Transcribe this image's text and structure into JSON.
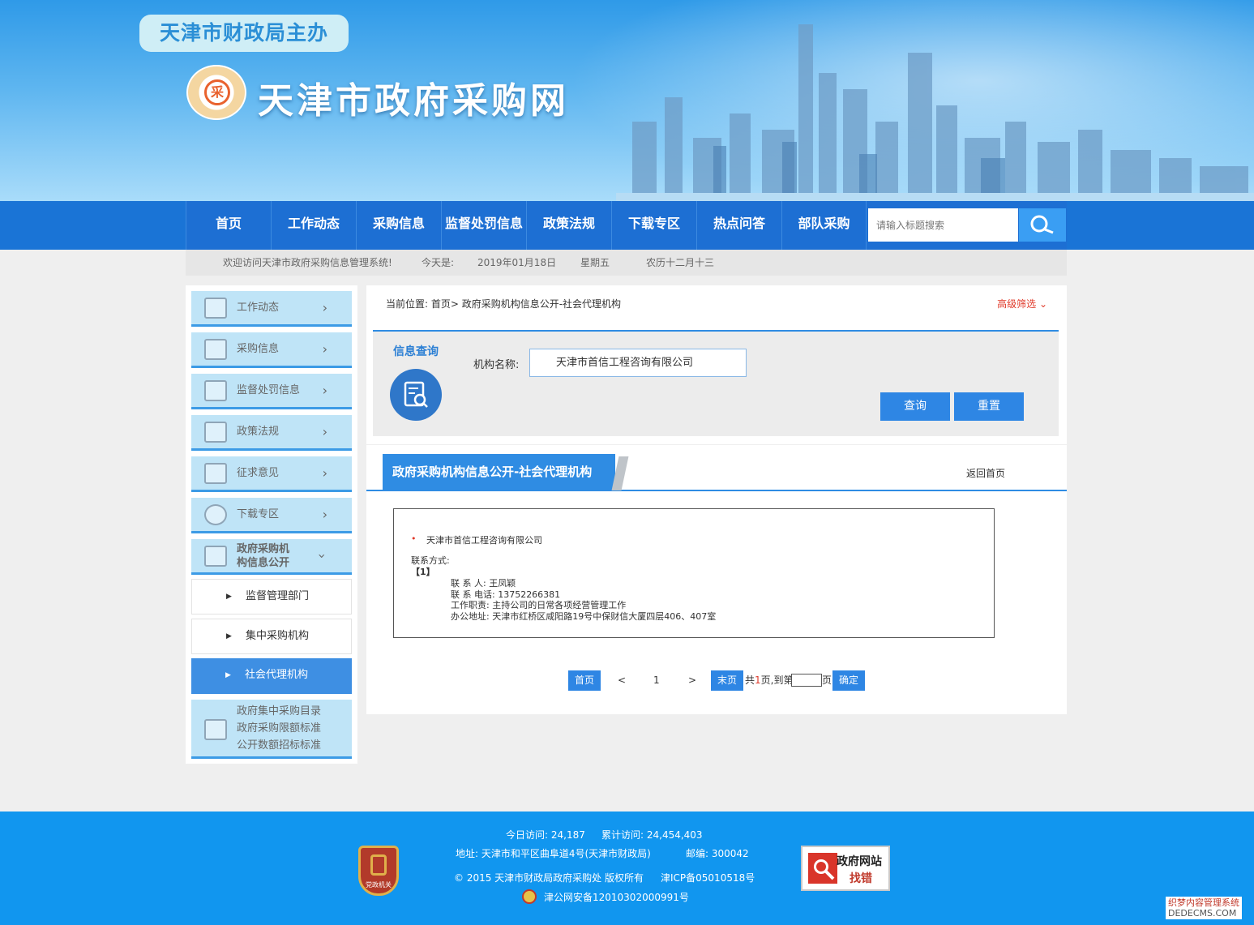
{
  "header": {
    "sponsor": "天津市财政局主办",
    "site_name": "天津市政府采购网",
    "logo_char": "采"
  },
  "nav": {
    "items": [
      "首页",
      "工作动态",
      "采购信息",
      "监督处罚信息",
      "政策法规",
      "下载专区",
      "热点问答",
      "部队采购"
    ],
    "search_placeholder": "请输入标题搜索"
  },
  "infobar": {
    "welcome": "欢迎访问天津市政府采购信息管理系统!",
    "today_label": "今天是:",
    "date": "2019年01月18日",
    "weekday": "星期五",
    "lunar": "农历十二月十三"
  },
  "sidebar": {
    "items": [
      "工作动态",
      "采购信息",
      "监督处罚信息",
      "政策法规",
      "征求意见",
      "下载专区"
    ],
    "expanded": {
      "line1": "政府采购机",
      "line2": "构信息公开"
    },
    "sub_items": [
      "监督管理部门",
      "集中采购机构",
      "社会代理机构"
    ],
    "bottom": [
      "政府集中采购目录",
      "政府采购限额标准",
      "公开数额招标标准"
    ]
  },
  "breadcrumb": "当前位置: 首页> 政府采购机构信息公开-社会代理机构",
  "advanced_filter": "高级筛选",
  "query": {
    "title": "信息查询",
    "label": "机构名称:",
    "value": "天津市首信工程咨询有限公司",
    "search_btn": "查询",
    "reset_btn": "重置"
  },
  "content": {
    "tab_title": "政府采购机构信息公开-社会代理机构",
    "back_home": "返回首页",
    "company": "天津市首信工程咨询有限公司",
    "contact_label": "联系方式:",
    "index": "【1】",
    "contact_person": "联 系 人: 王凤颖",
    "contact_phone": "联 系 电话: 13752266381",
    "duty": "工作职责: 主持公司的日常各项经营管理工作",
    "address": "办公地址: 天津市红桥区咸阳路19号中保财信大厦四层406、407室"
  },
  "pager": {
    "first": "首页",
    "prev": "<",
    "page": "1",
    "next": ">",
    "last": "末页",
    "total_prefix": "共",
    "total": "1",
    "total_suffix": "页,到第",
    "page_suffix": "页",
    "confirm": "确定"
  },
  "footer": {
    "today_visits": "今日访问: 24,187",
    "total_visits": "累计访问: 24,454,403",
    "address": "地址: 天津市和平区曲阜道4号(天津市财政局)",
    "postcode": "邮编: 300042",
    "copyright": "© 2015 天津市财政局政府采购处 版权所有",
    "icp": "津ICP备05010518号",
    "police": "津公网安备12010302000991号",
    "badge_text": "党政机关",
    "report_line1": "政府网站",
    "report_line2": "找错"
  },
  "watermark": {
    "line1": "织梦内容管理系统",
    "line2": "DEDECMS.COM"
  },
  "colors": {
    "nav_blue": "#1d6fd3",
    "accent_blue": "#2f8ce3",
    "footer_blue": "#1196ef",
    "filter_red": "#e03a2a"
  }
}
